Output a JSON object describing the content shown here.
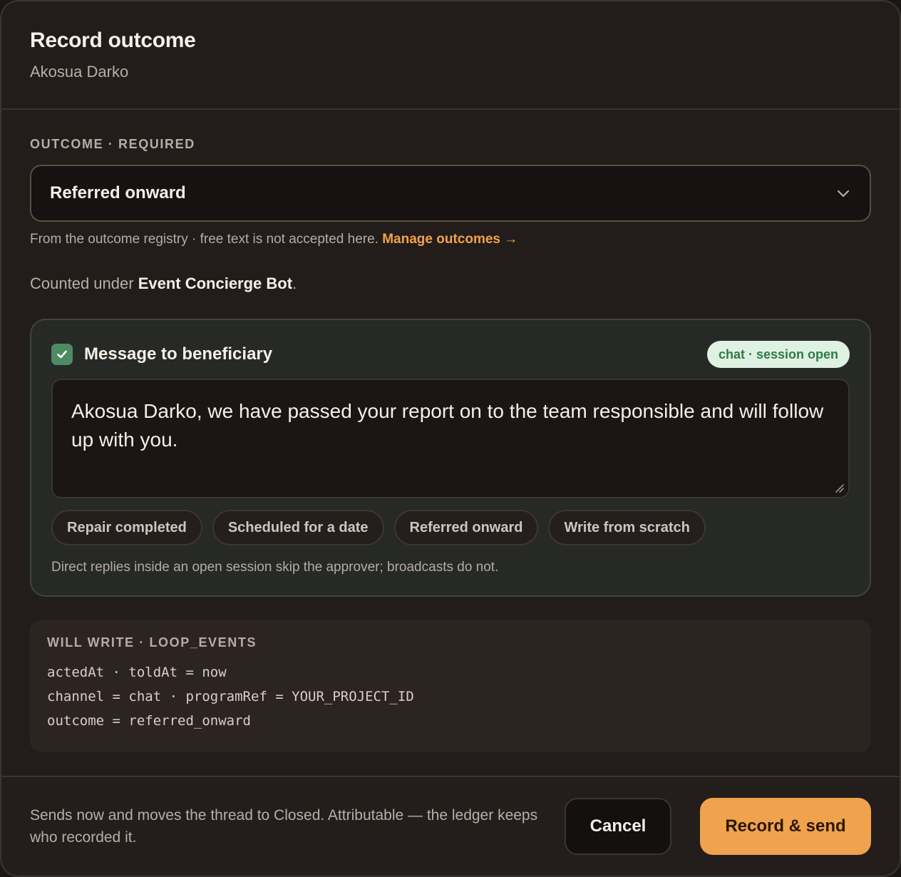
{
  "header": {
    "title": "Record outcome",
    "subtitle": "Akosua Darko"
  },
  "outcome": {
    "label": "OUTCOME · REQUIRED",
    "selected": "Referred onward",
    "helper_text": "From the outcome registry · free text is not accepted here.",
    "manage_link": "Manage outcomes →",
    "counted_prefix": "Counted under",
    "counted_program": "Event Concierge Bot",
    "counted_suffix": "."
  },
  "message": {
    "title": "Message to beneficiary",
    "checked": true,
    "channel_badge": "chat · session open",
    "text": "Akosua Darko, we have passed your report on to the team responsible and will follow up with you.",
    "templates": [
      {
        "label": "Repair completed"
      },
      {
        "label": "Scheduled for a date"
      },
      {
        "label": "Referred onward"
      },
      {
        "label": "Write from scratch"
      }
    ],
    "note": "Direct replies inside an open session skip the approver; broadcasts do not."
  },
  "writes": {
    "label": "WILL WRITE · LOOP_EVENTS",
    "lines": [
      "actedAt · toldAt = now",
      "channel = chat · programRef = YOUR_PROJECT_ID",
      "outcome = referred_onward"
    ]
  },
  "footer": {
    "text": "Sends now and moves the thread to Closed. Attributable — the ledger keeps who recorded it.",
    "cancel_label": "Cancel",
    "primary_label": "Record & send"
  },
  "colors": {
    "accent": "#f0a24d",
    "check": "#4e8a64",
    "badge_bg": "#dff1e3",
    "badge_text": "#2f7a46"
  }
}
